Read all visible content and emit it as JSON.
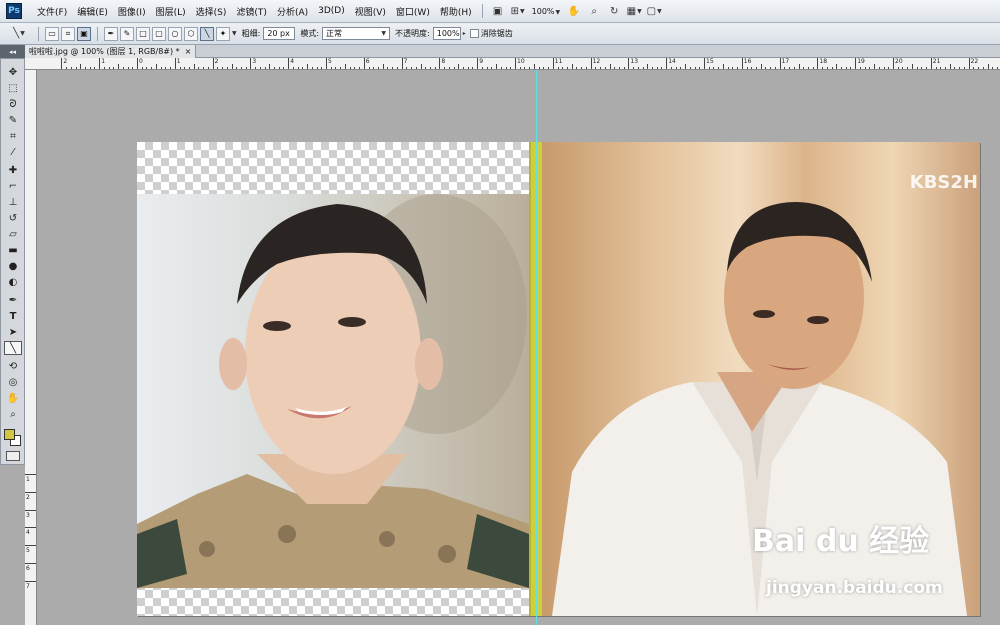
{
  "app": {
    "logo_text": "Ps"
  },
  "menubar": {
    "items": [
      "文件(F)",
      "编辑(E)",
      "图像(I)",
      "图层(L)",
      "选择(S)",
      "滤镜(T)",
      "分析(A)",
      "3D(D)",
      "视图(V)",
      "窗口(W)",
      "帮助(H)"
    ],
    "zoom": "100%"
  },
  "optionsbar": {
    "weight_label": "粗细:",
    "weight_value": "20 px",
    "mode_label": "模式:",
    "mode_value": "正常",
    "opacity_label": "不透明度:",
    "opacity_value": "100%",
    "antialias_label": "消除锯齿"
  },
  "document": {
    "tab_title": "啦啦啦.jpg @ 100% (图层 1, RGB/8#) *",
    "close_glyph": "×"
  },
  "ruler": {
    "h_labels": [
      "4",
      "3",
      "2",
      "1",
      "0",
      "1",
      "2",
      "3",
      "4",
      "5",
      "6",
      "7",
      "8",
      "9",
      "10",
      "11",
      "12",
      "13",
      "14",
      "15",
      "16",
      "17",
      "18",
      "19",
      "20",
      "21",
      "22",
      "23",
      "24",
      "25",
      "26",
      "27"
    ],
    "v_labels": [
      "1",
      "2",
      "3",
      "4",
      "5",
      "6",
      "7"
    ]
  },
  "tools": [
    "move-icon",
    "marquee-icon",
    "lasso-icon",
    "quick-select-icon",
    "crop-icon",
    "eyedropper-icon",
    "healing-icon",
    "brush-icon",
    "stamp-icon",
    "history-brush-icon",
    "eraser-icon",
    "gradient-icon",
    "blur-icon",
    "dodge-icon",
    "pen-icon",
    "type-icon",
    "path-select-icon",
    "line-icon",
    "3d-rotate-icon",
    "3d-orbit-icon",
    "hand-icon",
    "zoom-icon"
  ],
  "colors": {
    "foreground": "#d3c442",
    "background": "#ffffff",
    "guide": "#5ee0e8"
  },
  "canvas": {
    "kbs_logo": "KBS2H",
    "watermark_logo": "Bai du 经验",
    "watermark_url": "jingyan.baidu.com"
  }
}
